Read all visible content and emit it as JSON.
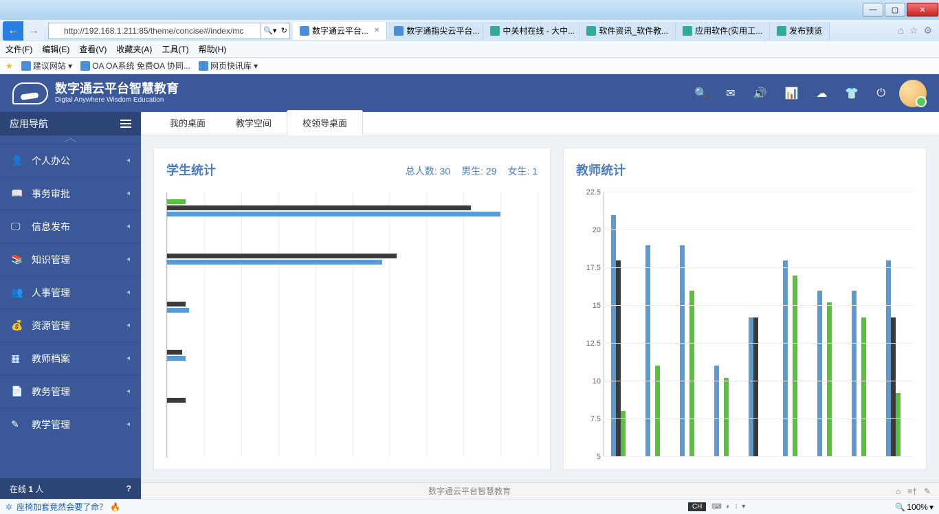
{
  "browser": {
    "url": "http://192.168.1.211:85/theme/concise#/index/mc",
    "tabs": [
      {
        "label": "数字通云平台...",
        "active": true,
        "favicon": "blue"
      },
      {
        "label": "数字通指尖云平台...",
        "favicon": "blue"
      },
      {
        "label": "中关村在线 - 大中...",
        "favicon": "green"
      },
      {
        "label": "软件资讯_软件教...",
        "favicon": "green"
      },
      {
        "label": "应用软件(实用工...",
        "favicon": "green"
      },
      {
        "label": "发布预览",
        "favicon": "green"
      }
    ],
    "menus": [
      "文件(F)",
      "编辑(E)",
      "查看(V)",
      "收藏夹(A)",
      "工具(T)",
      "帮助(H)"
    ],
    "bookmarks": [
      {
        "label": "建议网站 ▾"
      },
      {
        "label": "OA OA系统 免费OA 协同..."
      },
      {
        "label": "网页快讯库 ▾"
      }
    ]
  },
  "app": {
    "title": "数字通云平台智慧教育",
    "subtitle": "Digtal Anywhere Wisdom Education",
    "header_icons": [
      "search",
      "mail",
      "sound",
      "sitemap",
      "cloud",
      "shirt",
      "power"
    ]
  },
  "sidebar": {
    "title": "应用导航",
    "items": [
      {
        "label": "个人办公",
        "icon": "user"
      },
      {
        "label": "事务审批",
        "icon": "book"
      },
      {
        "label": "信息发布",
        "icon": "screen"
      },
      {
        "label": "知识管理",
        "icon": "books"
      },
      {
        "label": "人事管理",
        "icon": "users"
      },
      {
        "label": "资源管理",
        "icon": "money"
      },
      {
        "label": "教师档案",
        "icon": "grid"
      },
      {
        "label": "教务管理",
        "icon": "copy"
      },
      {
        "label": "教学管理",
        "icon": "pencil"
      }
    ],
    "online_label": "在线",
    "online_count": "1",
    "online_unit": "人",
    "help": "?"
  },
  "content": {
    "tabs": [
      "我的桌面",
      "教学空间",
      "校领导桌面"
    ],
    "active_tab": 2
  },
  "student_panel": {
    "title": "学生统计",
    "stats": {
      "total_label": "总人数:",
      "total": "30",
      "male_label": "男生:",
      "male": "29",
      "female_label": "女生:",
      "female": "1"
    }
  },
  "teacher_panel": {
    "title": "教师统计"
  },
  "chart_data": [
    {
      "type": "bar",
      "orientation": "horizontal",
      "title": "学生统计",
      "xlim": [
        0,
        100
      ],
      "series_colors": {
        "s1": "#56c33b",
        "s2": "#3a3a3a",
        "s3": "#5b9bd5"
      },
      "rows": [
        {
          "s1": 5,
          "s2": 82,
          "s3": 90
        },
        {
          "s1": 0,
          "s2": 62,
          "s3": 58
        },
        {
          "s1": 0,
          "s2": 5,
          "s3": 6
        },
        {
          "s1": 0,
          "s2": 4,
          "s3": 5
        },
        {
          "s1": 0,
          "s2": 5,
          "s3": 0
        }
      ]
    },
    {
      "type": "bar",
      "orientation": "vertical",
      "title": "教师统计",
      "ylim": [
        5,
        22.5
      ],
      "yticks": [
        5,
        7.5,
        10,
        12.5,
        15,
        17.5,
        20,
        22.5
      ],
      "series_colors": {
        "blue": "#5b9bd5",
        "black": "#3a3a3a",
        "green": "#56c33b"
      },
      "groups": [
        {
          "blue": 21,
          "black": 18,
          "green": 8
        },
        {
          "blue": 19,
          "black": null,
          "green": 11
        },
        {
          "blue": 19,
          "black": null,
          "green": 16
        },
        {
          "blue": 11,
          "black": null,
          "green": 10.2
        },
        {
          "blue": 14.2,
          "black": 14.2,
          "green": null
        },
        {
          "blue": 18,
          "black": null,
          "green": 17
        },
        {
          "blue": 16,
          "black": null,
          "green": 15.2
        },
        {
          "blue": 16,
          "black": null,
          "green": 14.2
        },
        {
          "blue": 18,
          "black": 14.2,
          "green": 9.2
        }
      ]
    }
  ],
  "footer": {
    "center": "数字通云平台智慧教育"
  },
  "statusbar": {
    "hot": "座椅加套竟然会要了命？",
    "lang": "CH",
    "zoom": "100%"
  }
}
